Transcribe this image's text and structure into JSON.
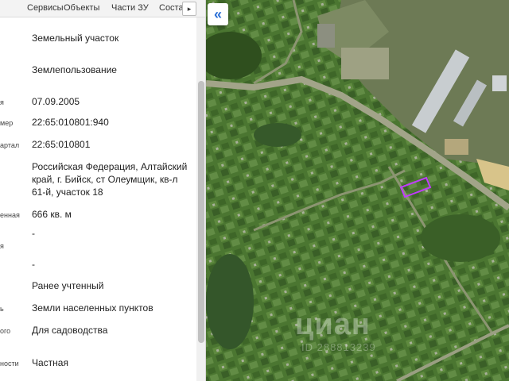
{
  "tabs": [
    "Сервисы",
    "Объекты",
    "Части ЗУ",
    "Соста"
  ],
  "tab_arrow": "▸",
  "rows": [
    {
      "label": "",
      "value": "Земельный участок"
    },
    {
      "label": "",
      "value": "Землепользование"
    },
    {
      "label": "я",
      "value": "07.09.2005"
    },
    {
      "label": "мер",
      "value": "22:65:010801:940"
    },
    {
      "label": "артал",
      "value": "22:65:010801"
    },
    {
      "label": "",
      "value": "Российская Федерация, Алтайский край, г. Бийск, ст Олеумщик, кв-л 61-й, участок 18"
    },
    {
      "label": "енная",
      "value": "666 кв. м"
    },
    {
      "label": "",
      "value": "-"
    },
    {
      "label": "я",
      "value": ""
    },
    {
      "label": "",
      "value": "-"
    },
    {
      "label": "",
      "value": "Ранее учтенный"
    },
    {
      "label": "ь",
      "value": "Земли населенных пунктов"
    },
    {
      "label": "ого",
      "value": "Для садоводства"
    },
    {
      "label": "ности",
      "value": "Частная"
    }
  ],
  "map": {
    "collapse_icon": "«",
    "watermark": "циан",
    "watermark_sub": "ID 288813239"
  }
}
